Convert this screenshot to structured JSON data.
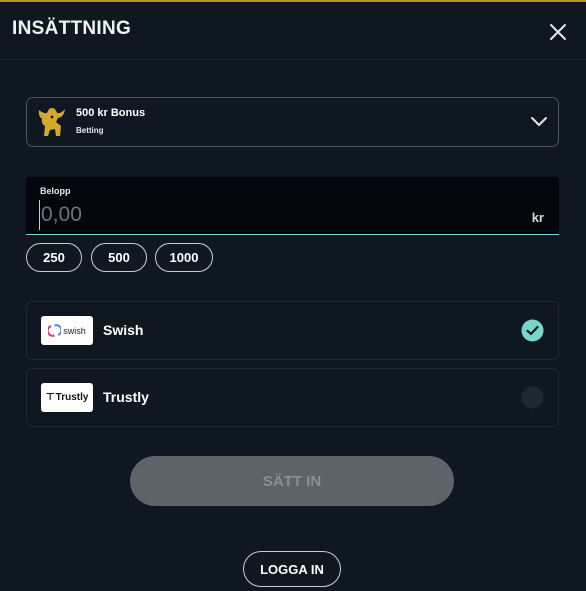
{
  "header": {
    "title": "INSÄTTNING",
    "close_icon": "close-icon"
  },
  "bonus": {
    "title": "500 kr Bonus",
    "subtitle": "Betting",
    "logo_icon": "bull-logo-icon",
    "chevron_icon": "chevron-down-icon"
  },
  "amount": {
    "label": "Belopp",
    "placeholder": "0,00",
    "value": "",
    "unit": "kr",
    "quick_amounts": [
      "250",
      "500",
      "1000"
    ]
  },
  "methods": [
    {
      "name": "Swish",
      "logo_text": "swish",
      "selected": true
    },
    {
      "name": "Trustly",
      "logo_text": "Trustly",
      "selected": false
    }
  ],
  "actions": {
    "submit_label": "SÄTT IN",
    "login_label": "LOGGA IN"
  },
  "colors": {
    "background": "#0f1821",
    "accent_teal": "#79d6cb",
    "gold": "#d4a82a",
    "disabled_button": "#5d6468"
  }
}
